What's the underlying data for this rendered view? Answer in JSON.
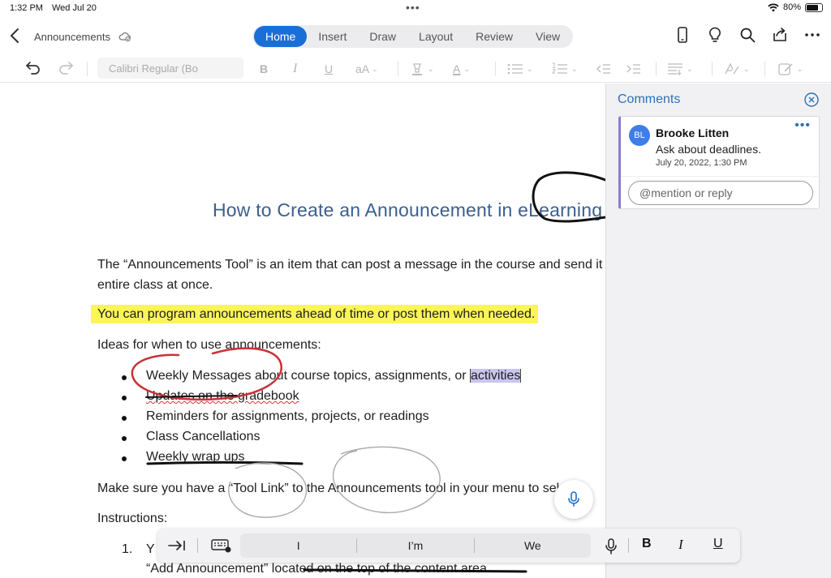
{
  "status": {
    "time": "1:32 PM",
    "date": "Wed Jul 20",
    "battery": "80%",
    "battery_level": 0.8
  },
  "titlebar": {
    "doc_name": "Announcements",
    "tabs": [
      {
        "label": "Home",
        "active": true
      },
      {
        "label": "Insert"
      },
      {
        "label": "Draw"
      },
      {
        "label": "Layout"
      },
      {
        "label": "Review"
      },
      {
        "label": "View"
      }
    ]
  },
  "ribbon": {
    "font": "Calibri Regular (Bo",
    "bold": "B",
    "italic": "I",
    "underline": "U",
    "font_size_glyph": "aA",
    "font_color_glyph": "A"
  },
  "document": {
    "title_visible": "How to Create an Announcement in eLearning",
    "para1_line1": "The “Announcements Tool” is an item that can post a message in the course and send it to the",
    "para1_line2": "entire class at once.",
    "para2": "You can program announcements ahead of time or post them when needed.",
    "ideas_heading": "Ideas for when to use announcements:",
    "bullet1_pre": "Weekly Messages about course topics, assignments, or ",
    "bullet1_selected": "activities",
    "bullet2": "Updates on the gradebook",
    "bullet3": "Reminders for assignments, projects, or readings",
    "bullet4": "Class Cancellations",
    "bullet5": "Weekly wrap ups",
    "para3": "Make sure you have a “Tool Link” to the Announcements tool in your menu to select",
    "instructions": "Instructions:",
    "step1_num": "1.",
    "step1_line1": "Y",
    "step1_line2": "“Add Announcement” located on the top of the content area."
  },
  "comments": {
    "title": "Comments",
    "items": [
      {
        "initials": "BL",
        "author": "Brooke Litten",
        "text": "Ask about deadlines.",
        "date": "July 20, 2022, 1:30 PM",
        "more": "•••"
      }
    ],
    "reply_placeholder": "@mention or reply"
  },
  "keyboard_bar": {
    "suggestions": [
      "I",
      "I’m",
      "We"
    ],
    "bold": "B",
    "italic": "I",
    "underline": "U"
  },
  "colors": {
    "accent": "#1a6ed8",
    "highlight": "#fbf55a",
    "selection": "#c8c5ee",
    "comment_bar": "#8b7bd1",
    "title_blue": "#3a5f8f"
  }
}
